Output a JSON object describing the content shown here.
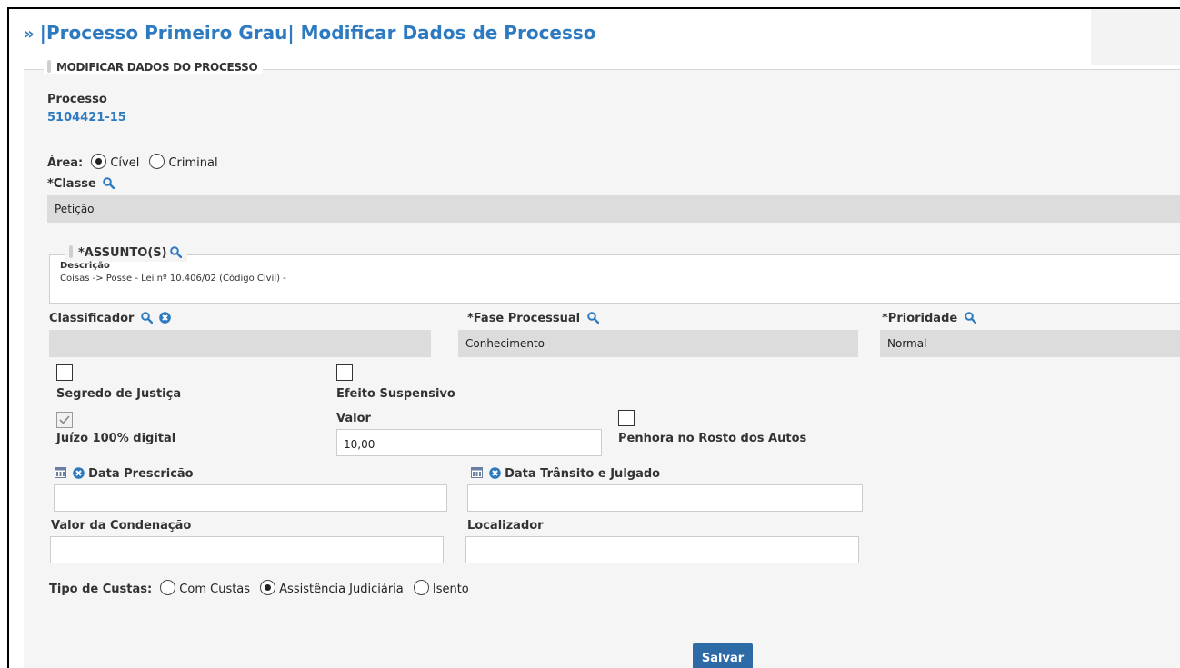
{
  "header": {
    "arrow": "»",
    "title": "|Processo Primeiro Grau| Modificar Dados de Processo"
  },
  "section": {
    "legend": "MODIFICAR DADOS DO PROCESSO"
  },
  "processo": {
    "label": "Processo",
    "number": "5104421-15"
  },
  "area": {
    "label": "Área:",
    "options": [
      {
        "label": "Cível",
        "selected": true
      },
      {
        "label": "Criminal",
        "selected": false
      }
    ]
  },
  "classe": {
    "label": "*Classe",
    "value": "Petição"
  },
  "assunto": {
    "legend": "*ASSUNTO(S)",
    "desc_label": "Descrição",
    "desc_value": "Coisas -> Posse - Lei nº 10.406/02 (Código Civil) -"
  },
  "classificador": {
    "label": "Classificador",
    "value": ""
  },
  "fase": {
    "label": "*Fase Processual",
    "value": "Conhecimento"
  },
  "prioridade": {
    "label": "*Prioridade",
    "value": "Normal"
  },
  "segredo": {
    "label": "Segredo de Justiça",
    "checked": false
  },
  "efeito": {
    "label": "Efeito Suspensivo",
    "checked": false
  },
  "juizo": {
    "label": "Juízo 100% digital",
    "checked": true,
    "disabled": true
  },
  "valor": {
    "label": "Valor",
    "value": "10,00"
  },
  "penhora": {
    "label": "Penhora no Rosto dos Autos",
    "checked": false
  },
  "data_prescricao": {
    "label": "Data Prescricão",
    "value": ""
  },
  "data_transito": {
    "label": "Data Trânsito e Julgado",
    "value": ""
  },
  "valor_condenacao": {
    "label": "Valor da Condenação",
    "value": ""
  },
  "localizador": {
    "label": "Localizador",
    "value": ""
  },
  "custas": {
    "label": "Tipo de Custas:",
    "options": [
      {
        "label": "Com Custas",
        "selected": false
      },
      {
        "label": "Assistência Judiciária",
        "selected": true
      },
      {
        "label": "Isento",
        "selected": false
      }
    ]
  },
  "actions": {
    "save_label": "Salvar"
  },
  "colors": {
    "accent": "#2d7ac0",
    "button": "#2d6aa6",
    "readonly_bg": "#dcdcdc"
  },
  "icons": [
    "search-icon",
    "clear-icon",
    "calendar-icon",
    "check-icon"
  ]
}
